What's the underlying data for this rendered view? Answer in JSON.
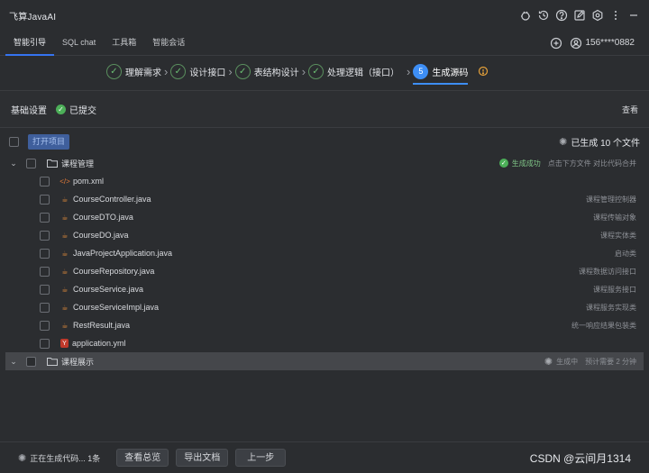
{
  "app": {
    "title": "飞算JavaAI"
  },
  "tabs": [
    {
      "label": "智能引导",
      "active": true
    },
    {
      "label": "SQL chat"
    },
    {
      "label": "工具箱"
    },
    {
      "label": "智能会话"
    }
  ],
  "user": {
    "id": "156****0882"
  },
  "steps": [
    {
      "label": "理解需求",
      "state": "done"
    },
    {
      "label": "设计接口",
      "state": "done"
    },
    {
      "label": "表结构设计",
      "state": "done"
    },
    {
      "label": "处理逻辑（接口）",
      "state": "done"
    },
    {
      "number": "5",
      "label": "生成源码",
      "state": "current"
    }
  ],
  "basic": {
    "title": "基础设置",
    "status": "已提交",
    "view": "查看"
  },
  "list": {
    "open_label": "打开项目",
    "generated": "已生成 10 个文件"
  },
  "folder1": {
    "name": "课程管理",
    "status": "生成成功",
    "hint": "点击下方文件 对比代码合并",
    "files": [
      {
        "name": "pom.xml",
        "icon": "xml-icon",
        "desc": ""
      },
      {
        "name": "CourseController.java",
        "icon": "java-icon",
        "desc": "课程管理控制器"
      },
      {
        "name": "CourseDTO.java",
        "icon": "java-icon",
        "desc": "课程传输对象"
      },
      {
        "name": "CourseDO.java",
        "icon": "java-icon",
        "desc": "课程实体类"
      },
      {
        "name": "JavaProjectApplication.java",
        "icon": "java-icon",
        "desc": "启动类"
      },
      {
        "name": "CourseRepository.java",
        "icon": "java-icon",
        "desc": "课程数据访问接口"
      },
      {
        "name": "CourseService.java",
        "icon": "java-icon",
        "desc": "课程服务接口"
      },
      {
        "name": "CourseServiceImpl.java",
        "icon": "java-icon",
        "desc": "课程服务实现类"
      },
      {
        "name": "RestResult.java",
        "icon": "java-icon",
        "desc": "统一响应结果包装类"
      },
      {
        "name": "application.yml",
        "icon": "yml-icon",
        "desc": ""
      }
    ]
  },
  "folder2": {
    "name": "课程展示",
    "status": "生成中",
    "eta": "预计需要 2 分钟"
  },
  "bottom": {
    "status": "正在生成代码... 1条",
    "btn_overview": "查看总览",
    "btn_export": "导出文档",
    "btn_prev": "上一步",
    "watermark": "CSDN @云间月1314"
  },
  "colors": {
    "accent": "#3d8ef5",
    "success": "#4caf58",
    "warning": "#e5a13a"
  }
}
